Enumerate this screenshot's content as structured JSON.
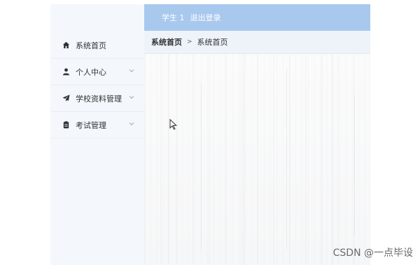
{
  "sidebar": {
    "items": [
      {
        "label": "系统首页",
        "icon": "home-icon",
        "expandable": false
      },
      {
        "label": "个人中心",
        "icon": "user-icon",
        "expandable": true
      },
      {
        "label": "学校资料管理",
        "icon": "paper-plane-icon",
        "expandable": true
      },
      {
        "label": "考试管理",
        "icon": "clipboard-icon",
        "expandable": true
      }
    ]
  },
  "header": {
    "user": "学生 1",
    "logout": "退出登录"
  },
  "breadcrumb": {
    "root": "系统首页",
    "separator": ">",
    "current": "系统首页"
  },
  "watermark": "CSDN @一点毕设",
  "colors": {
    "header_bg": "#a8c8ee",
    "sidebar_bg": "#f4f8fc",
    "breadcrumb_bg": "#eef3f9"
  }
}
